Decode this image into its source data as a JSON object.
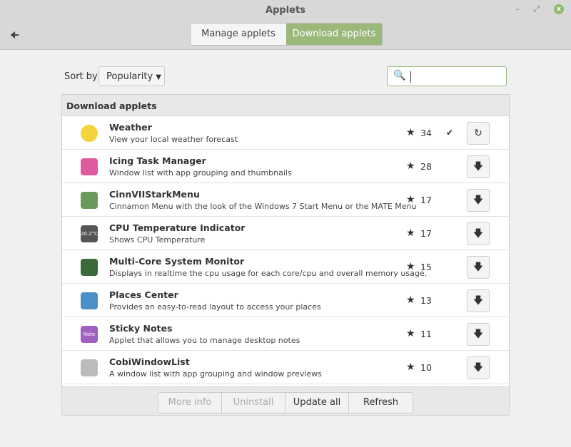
{
  "window": {
    "title": "Applets"
  },
  "tabs": [
    {
      "label": "Manage applets"
    },
    {
      "label": "Download applets"
    }
  ],
  "sort": {
    "label": "Sort by",
    "value": "Popularity"
  },
  "search": {
    "value": ""
  },
  "panel": {
    "header": "Download applets"
  },
  "applets": [
    {
      "name": "Weather",
      "desc": "View your local weather forecast",
      "score": "34",
      "installed": true,
      "color": "#f5d33c"
    },
    {
      "name": "Icing Task Manager",
      "desc": "Window list with app grouping and thumbnails",
      "score": "28",
      "installed": false,
      "color": "#e05aa0"
    },
    {
      "name": "CinnVIIStarkMenu",
      "desc": "Cinnamon Menu with the look of the Windows 7 Start Menu or the MATE Menu",
      "score": "17",
      "installed": false,
      "color": "#6a9a5a"
    },
    {
      "name": "CPU Temperature Indicator",
      "desc": "Shows CPU Temperature",
      "score": "17",
      "installed": false,
      "color": "#555555",
      "label": "20.2°C"
    },
    {
      "name": "Multi-Core System Monitor",
      "desc": "Displays in realtime the cpu usage for each core/cpu and overall memory usage.",
      "score": "15",
      "installed": false,
      "color": "#3a6a3a"
    },
    {
      "name": "Places Center",
      "desc": "Provides an easy-to-read layout to access your places",
      "score": "13",
      "installed": false,
      "color": "#4a90c8"
    },
    {
      "name": "Sticky Notes",
      "desc": "Applet that allows you to manage desktop notes",
      "score": "11",
      "installed": false,
      "color": "#a060c0",
      "label": "Note"
    },
    {
      "name": "CobiWindowList",
      "desc": "A window list with app grouping and window previews",
      "score": "10",
      "installed": false,
      "color": "#bbbbbb"
    }
  ],
  "footer": [
    "More info",
    "Uninstall",
    "Update all",
    "Refresh"
  ]
}
